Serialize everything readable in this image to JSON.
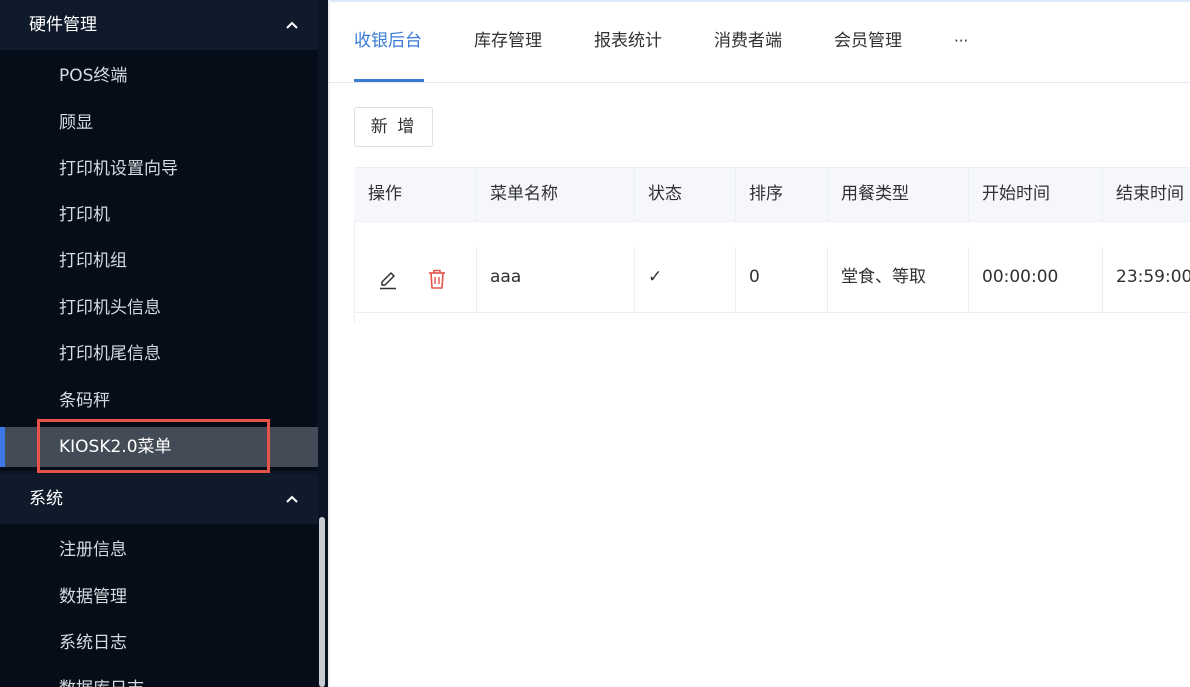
{
  "sidebar": {
    "groups": [
      {
        "title": "硬件管理",
        "items": [
          {
            "label": "POS终端"
          },
          {
            "label": "顾显"
          },
          {
            "label": "打印机设置向导"
          },
          {
            "label": "打印机"
          },
          {
            "label": "打印机组"
          },
          {
            "label": "打印机头信息"
          },
          {
            "label": "打印机尾信息"
          },
          {
            "label": "条码秤"
          },
          {
            "label": "KIOSK2.0菜单"
          }
        ]
      },
      {
        "title": "系统",
        "items": [
          {
            "label": "注册信息"
          },
          {
            "label": "数据管理"
          },
          {
            "label": "系统日志"
          },
          {
            "label": "数据库日志"
          }
        ]
      }
    ],
    "active_item": "KIOSK2.0菜单"
  },
  "tabs": [
    {
      "label": "收银后台"
    },
    {
      "label": "库存管理"
    },
    {
      "label": "报表统计"
    },
    {
      "label": "消费者端"
    },
    {
      "label": "会员管理"
    },
    {
      "label": "···"
    }
  ],
  "active_tab": "收银后台",
  "toolbar": {
    "add_label": "新 增"
  },
  "table": {
    "columns": [
      "操作",
      "菜单名称",
      "状态",
      "排序",
      "用餐类型",
      "开始时间",
      "结束时间"
    ],
    "rows": [
      {
        "name": "aaa",
        "status": "✓",
        "sort": "0",
        "meal_type": "堂食、等取",
        "start_time": "00:00:00",
        "end_time": "23:59:00"
      }
    ]
  },
  "icons": {
    "edit": "edit-icon",
    "delete": "trash-icon",
    "collapse": "chevron-up-icon"
  },
  "colors": {
    "sidebar_bg": "#0c1523",
    "active_item_bg": "#434b56",
    "accent": "#3a7bd5",
    "highlight_box": "#e5534b",
    "delete_icon": "#e5534b"
  }
}
